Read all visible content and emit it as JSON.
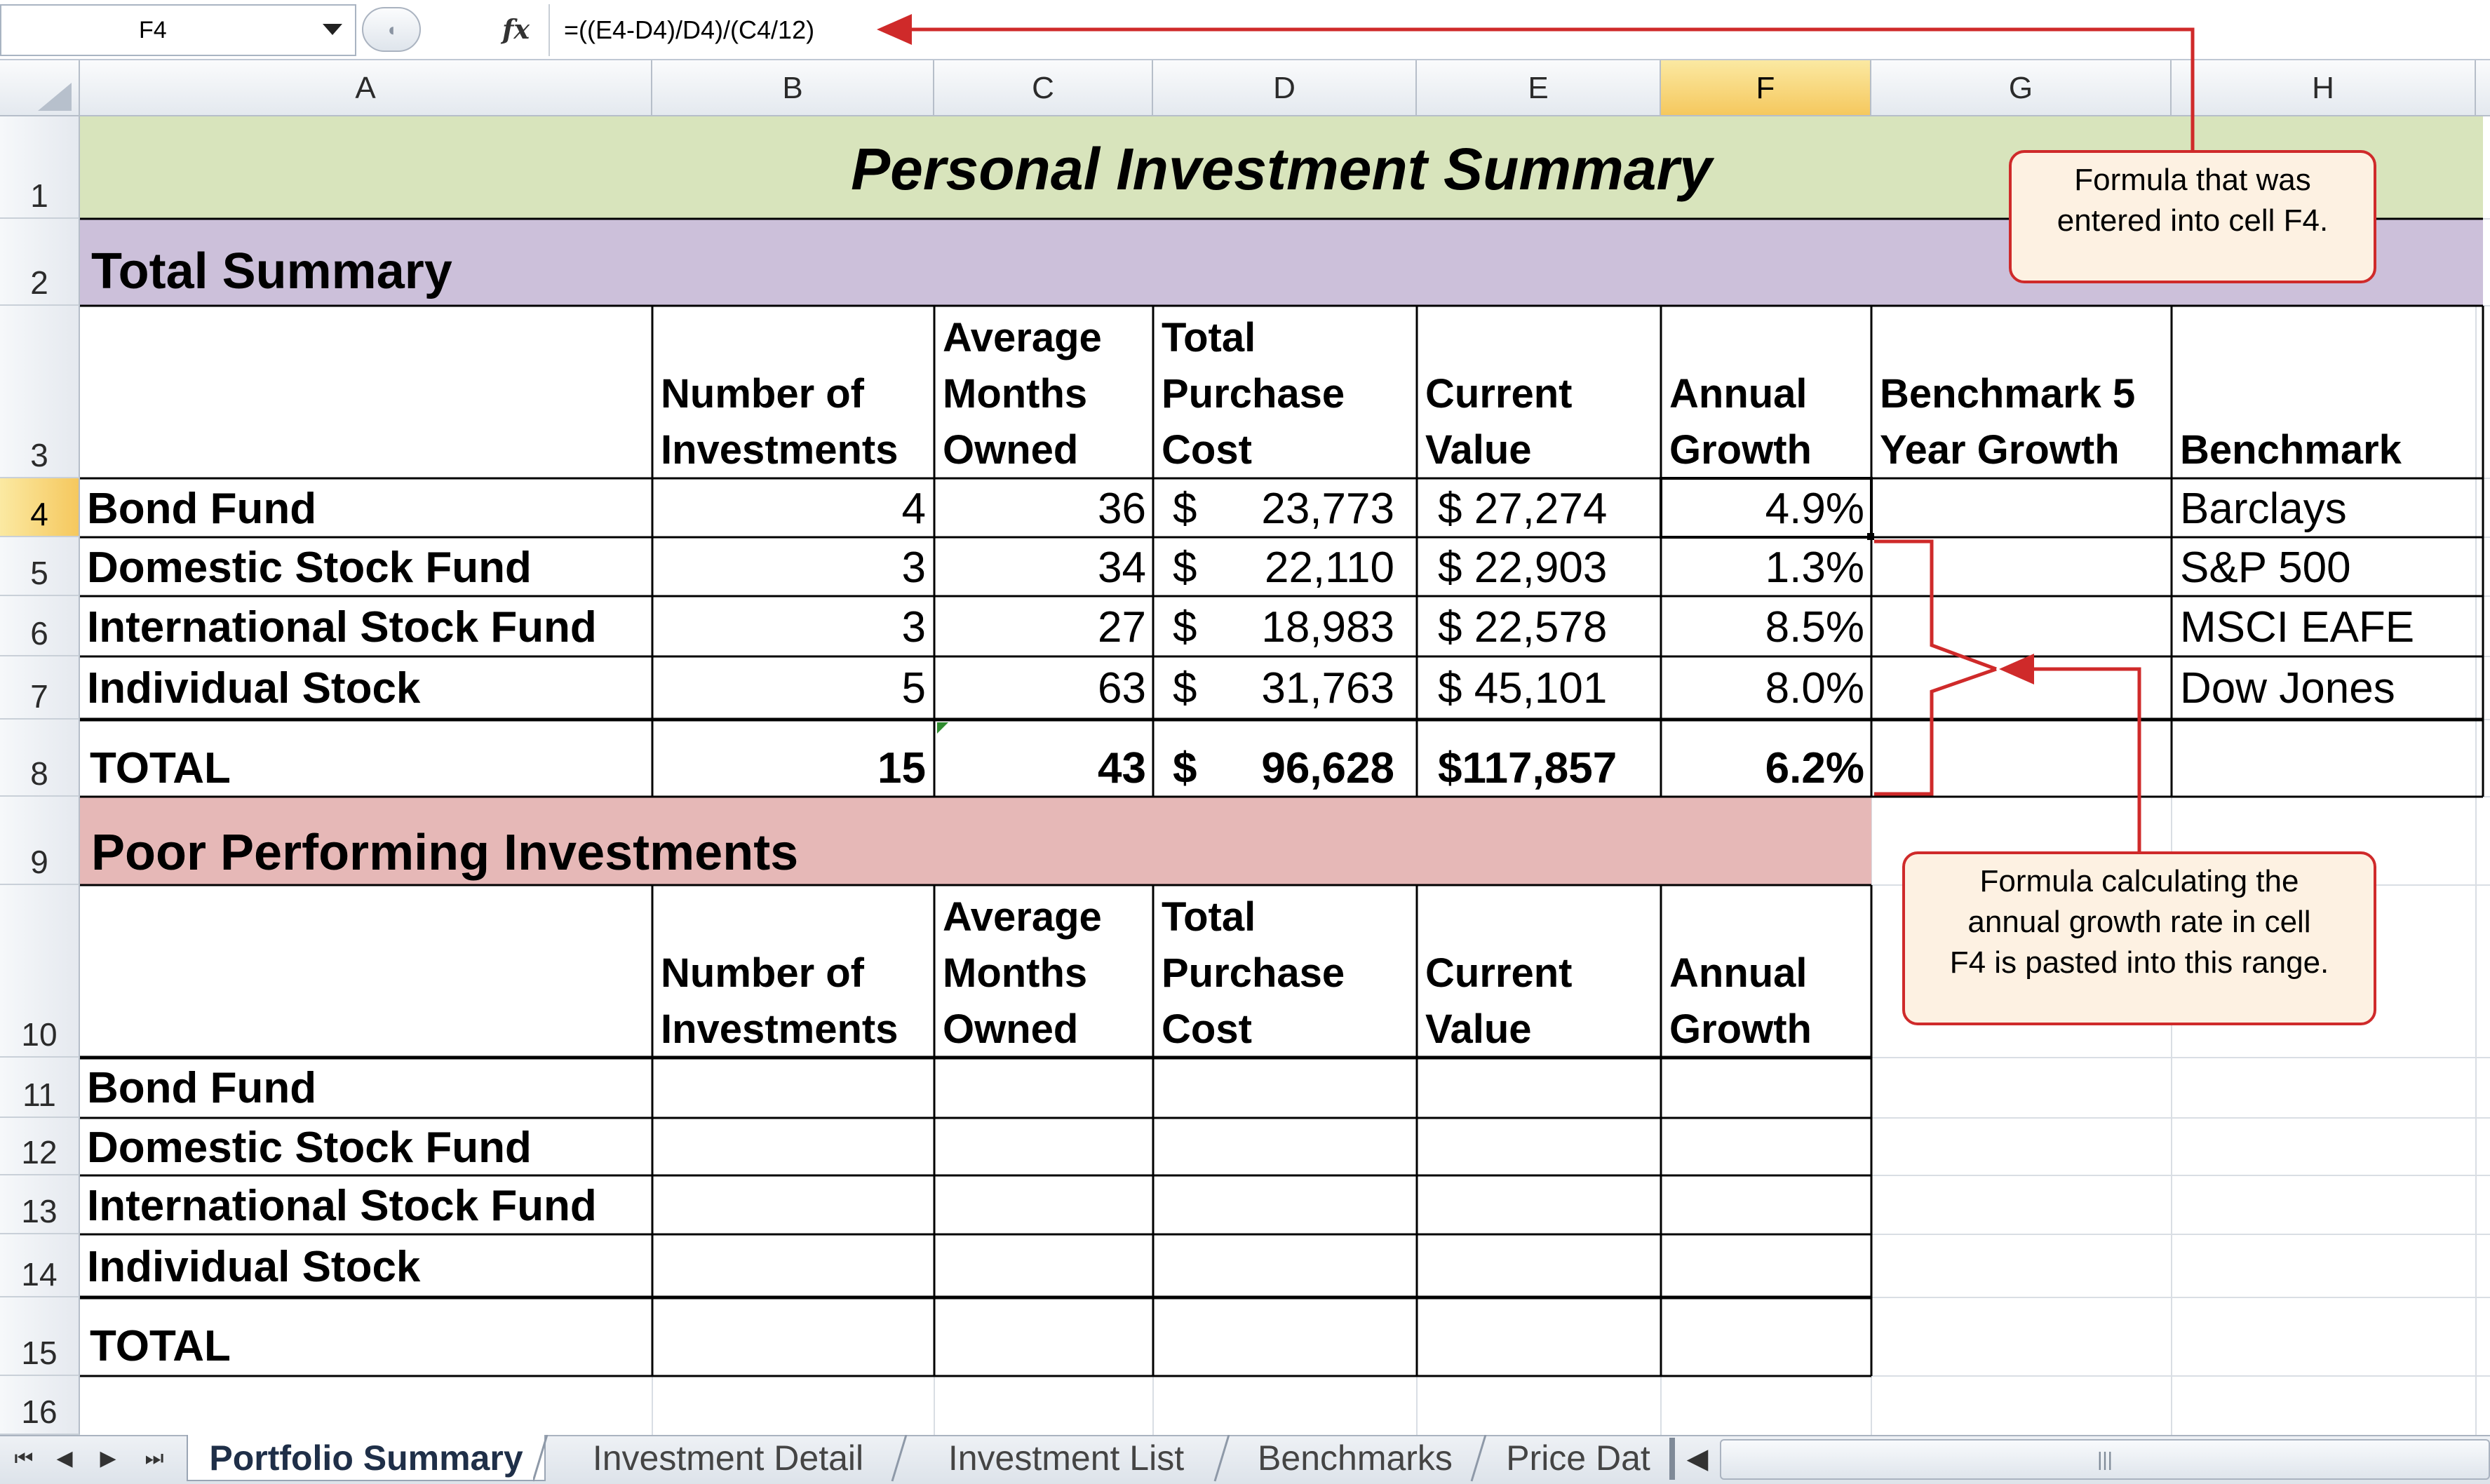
{
  "formula_bar": {
    "name_box": "F4",
    "fx_symbol": "fx",
    "formula": "=((E4-D4)/D4)/(C4/12)"
  },
  "columns": [
    "A",
    "B",
    "C",
    "D",
    "E",
    "F",
    "G",
    "H"
  ],
  "selected_column": "F",
  "rows": [
    "1",
    "2",
    "3",
    "4",
    "5",
    "6",
    "7",
    "8",
    "9",
    "10",
    "11",
    "12",
    "13",
    "14",
    "15",
    "16"
  ],
  "selected_row": "4",
  "sheet": {
    "title": "Personal Investment Summary",
    "total_summary_heading": "Total Summary",
    "poor_heading": "Poor Performing Investments",
    "headers": {
      "b": "Number of\nInvestments",
      "c": "Average\nMonths\nOwned",
      "d": "Total\nPurchase\nCost",
      "e": "Current\nValue",
      "f": "Annual\nGrowth",
      "g": "Benchmark 5\nYear Growth",
      "h": "Benchmark"
    },
    "investments": [
      {
        "name": "Bond Fund",
        "count": "4",
        "months": "36",
        "cost": "23,773",
        "value": "$  27,274",
        "growth": "4.9%",
        "benchmark": "Barclays"
      },
      {
        "name": "Domestic Stock Fund",
        "count": "3",
        "months": "34",
        "cost": "22,110",
        "value": "$  22,903",
        "growth": "1.3%",
        "benchmark": "S&P 500"
      },
      {
        "name": "International Stock Fund",
        "count": "3",
        "months": "27",
        "cost": "18,983",
        "value": "$  22,578",
        "growth": "8.5%",
        "benchmark": "MSCI EAFE"
      },
      {
        "name": "Individual Stock",
        "count": "5",
        "months": "63",
        "cost": "31,763",
        "value": "$  45,101",
        "growth": "8.0%",
        "benchmark": "Dow Jones"
      }
    ],
    "total": {
      "name": "TOTAL",
      "count": "15",
      "months": "43",
      "cost": "96,628",
      "value": "$117,857",
      "growth": "6.2%"
    },
    "currency_symbol": "$",
    "poor_rows": [
      "Bond Fund",
      "Domestic Stock Fund",
      "International Stock Fund",
      "Individual Stock"
    ],
    "poor_total": "TOTAL"
  },
  "callouts": {
    "formula_note": "Formula that was\nentered into cell F4.",
    "paste_note": "Formula calculating the\nannual growth rate in cell\nF4 is pasted into this range."
  },
  "sheet_tabs": [
    "Portfolio Summary",
    "Investment Detail",
    "Investment List",
    "Benchmarks",
    "Price Dat"
  ],
  "active_tab": "Portfolio Summary",
  "colors": {
    "title_fill": "#d8e4bc",
    "total_summary_fill": "#ccc0da",
    "poor_fill": "#e6b8b7",
    "callout_border": "#cf2a2a",
    "callout_fill": "#fdf1e2",
    "selection": "#f5c85e"
  }
}
